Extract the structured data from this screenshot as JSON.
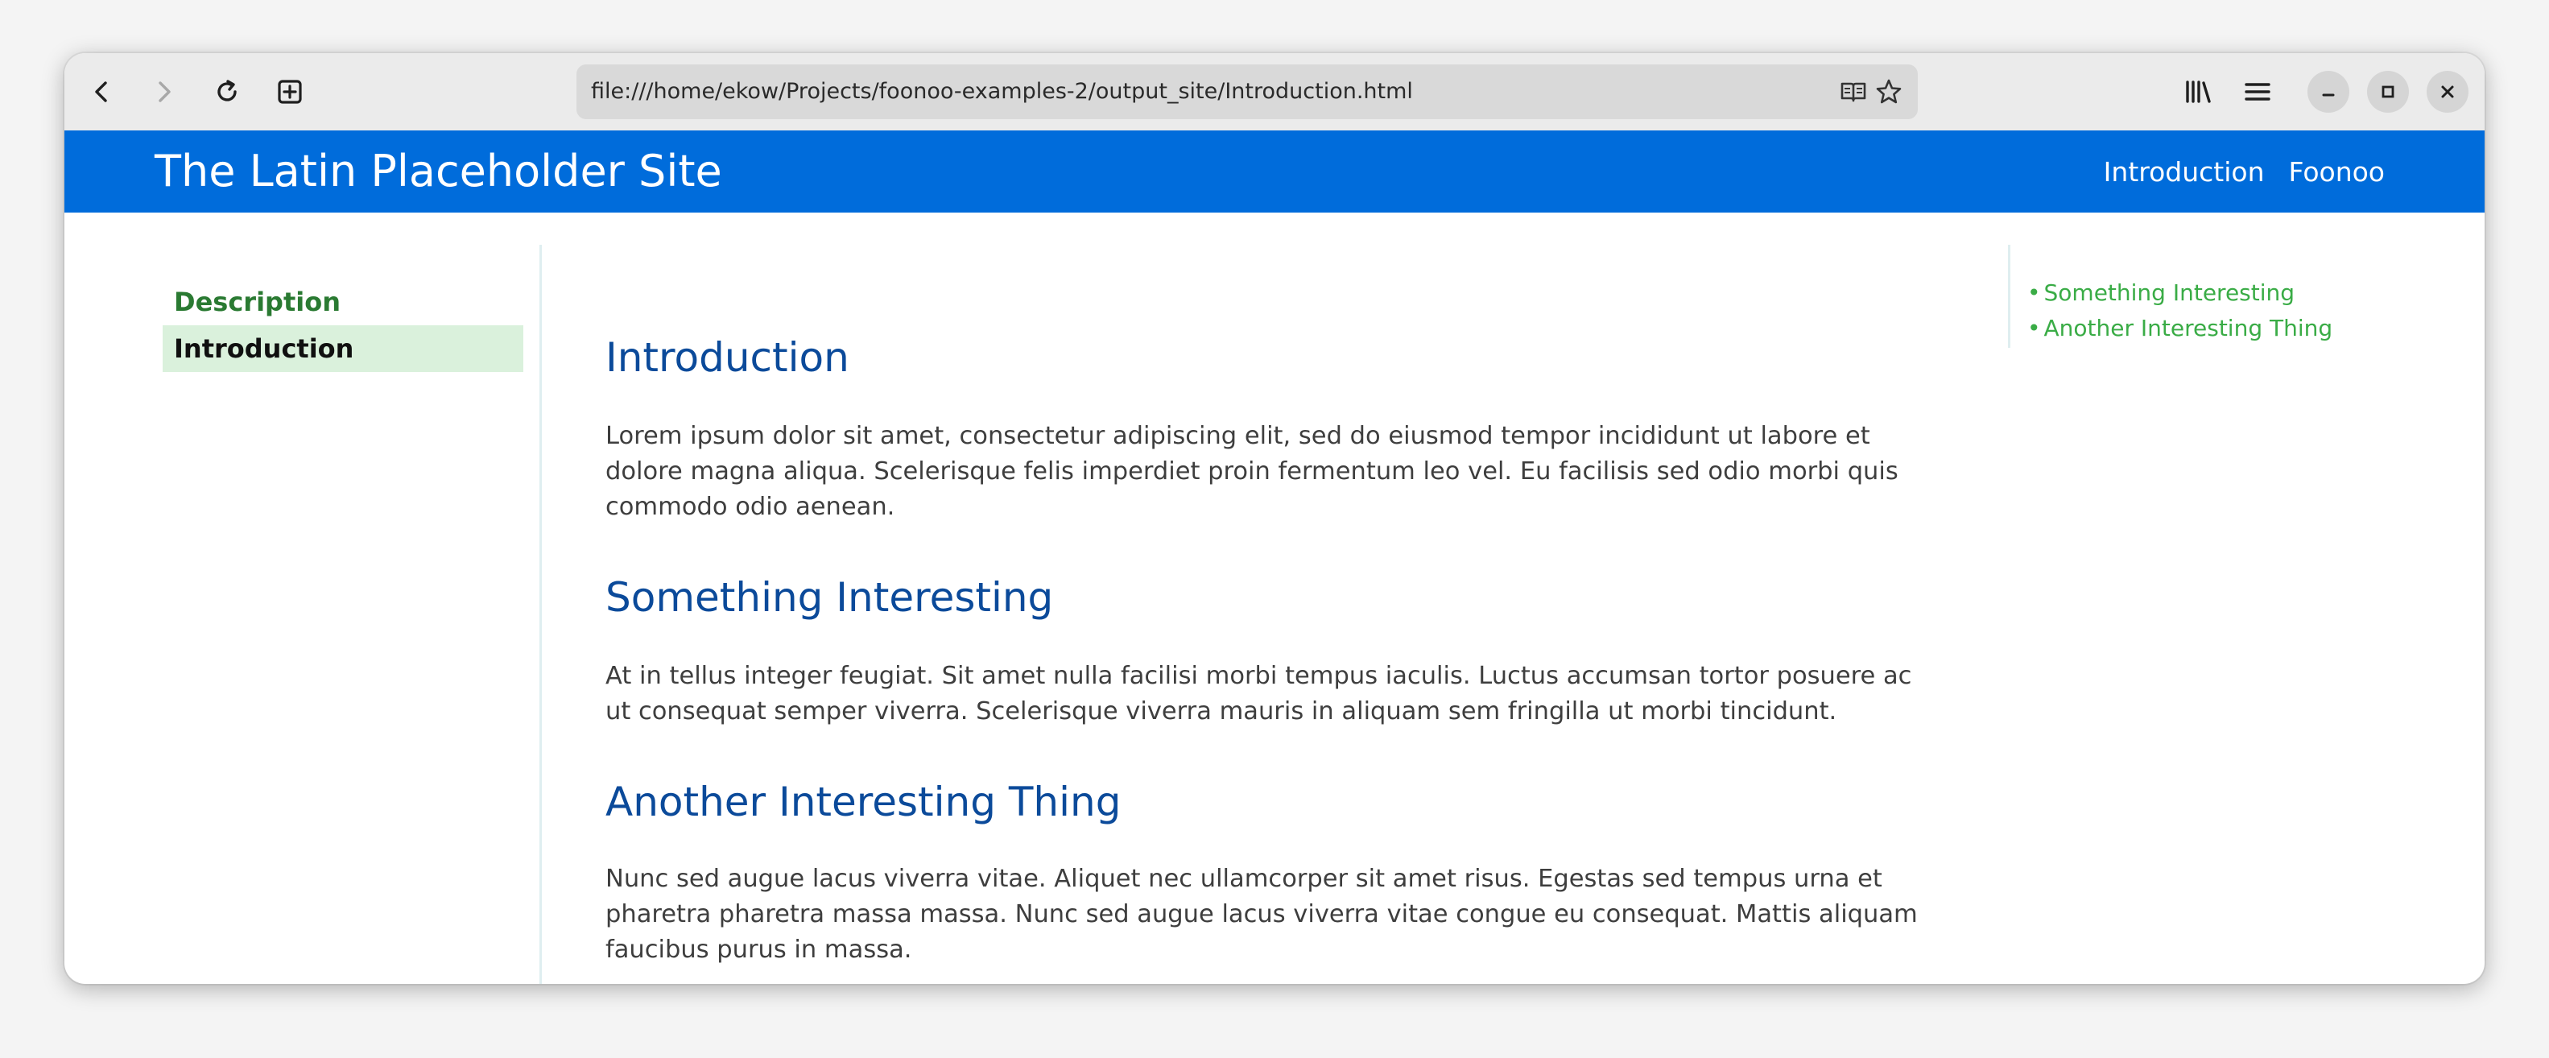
{
  "browser": {
    "url": "file:///home/ekow/Projects/foonoo-examples-2/output_site/Introduction.html",
    "icons": {
      "back": "back-arrow-icon",
      "forward": "forward-arrow-icon",
      "reload": "reload-icon",
      "new_tab": "new-tab-plus-icon",
      "reader": "reader-view-icon",
      "bookmark": "star-icon",
      "library": "library-icon",
      "menu": "hamburger-menu-icon",
      "minimize": "minimize-icon",
      "maximize": "maximize-icon",
      "close": "close-icon"
    }
  },
  "site": {
    "title": "The Latin Placeholder Site",
    "nav": [
      "Introduction",
      "Foonoo"
    ],
    "header_color": "#006cdb"
  },
  "sidebar": {
    "items": [
      {
        "label": "Description",
        "active": false
      },
      {
        "label": "Introduction",
        "active": true
      }
    ]
  },
  "main": {
    "title": "Introduction",
    "intro": "Lorem ipsum dolor sit amet, consectetur adipiscing elit, sed do eiusmod tempor incididunt ut labore et dolore magna aliqua. Scelerisque felis imperdiet proin fermentum leo vel. Eu facilisis sed odio morbi quis commodo odio aenean.",
    "sections": [
      {
        "heading": "Something Interesting",
        "text": "At in tellus integer feugiat. Sit amet nulla facilisi morbi tempus iaculis. Luctus accumsan tortor posuere ac ut consequat semper viverra. Scelerisque viverra mauris in aliquam sem fringilla ut morbi tincidunt."
      },
      {
        "heading": "Another Interesting Thing",
        "text": "Nunc sed augue lacus viverra vitae. Aliquet nec ullamcorper sit amet risus. Egestas sed tempus urna et pharetra pharetra massa massa. Nunc sed augue lacus viverra vitae congue eu consequat. Mattis aliquam faucibus purus in massa."
      }
    ]
  },
  "toc": {
    "items": [
      "Something Interesting",
      "Another Interesting Thing"
    ]
  }
}
